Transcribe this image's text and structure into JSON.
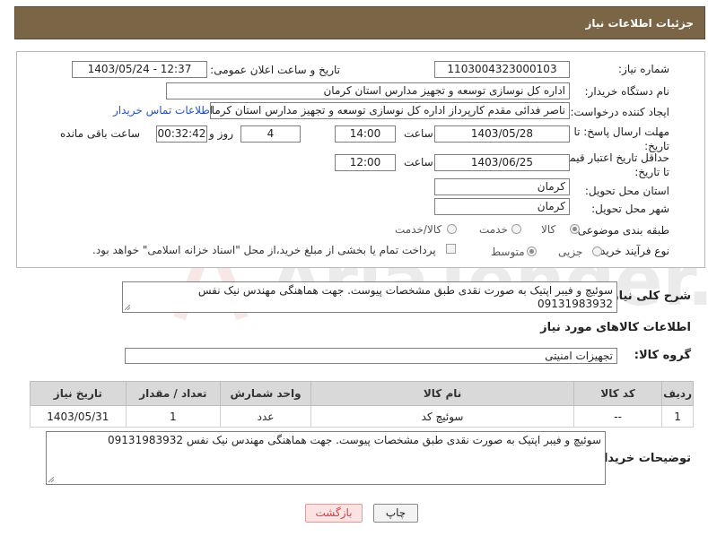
{
  "header": {
    "title": "جزئیات اطلاعات نیاز"
  },
  "form": {
    "need_number_label": "شماره نیاز:",
    "need_number": "1103004323000103",
    "announce_label": "تاریخ و ساعت اعلان عمومی:",
    "announce_value": "1403/05/24 - 12:37",
    "buyer_label": "نام دستگاه خریدار:",
    "buyer_value": "اداره کل نوسازی  توسعه و تجهیز مدارس استان کرمان",
    "creator_label": "ایجاد کننده درخواست:",
    "creator_value": "ناصر فدائی مقدم کارپرداز اداره کل نوسازی  توسعه و تجهیز مدارس استان کرمان",
    "contact_link": "اطلاعات تماس خریدار",
    "deadline_label": "مهلت ارسال پاسخ: تا تاریخ:",
    "deadline_date": "1403/05/28",
    "time_label": "ساعت",
    "deadline_time": "14:00",
    "days_value": "4",
    "days_label": "روز و",
    "remaining_time": "00:32:42",
    "remaining_label": "ساعت باقی مانده",
    "validity_label": "حداقل تاریخ اعتبار قیمت: تا تاریخ:",
    "validity_date": "1403/06/25",
    "validity_time": "12:00",
    "province_label": "استان محل تحویل:",
    "province_value": "کرمان",
    "city_label": "شهر محل تحویل:",
    "city_value": "کرمان",
    "category_label": "طبقه بندی موضوعی:",
    "category_options": [
      "کالا",
      "خدمت",
      "کالا/خدمت"
    ],
    "category_selected": "کالا",
    "process_label": "نوع فرآیند خرید :",
    "process_options": [
      "جزیی",
      "متوسط"
    ],
    "process_selected": "متوسط",
    "payment_note": "پرداخت تمام یا بخشی از مبلغ خرید،از محل \"اسناد خزانه اسلامی\" خواهد بود."
  },
  "summary": {
    "label": "شرح کلی نیاز:",
    "text_line1": "سوئیچ و فیبر اپتیک به صورت نقدی طبق مشخصات پیوست. جهت هماهنگی مهندس نیک نفس",
    "text_line2": "09131983932"
  },
  "goods": {
    "section_title": "اطلاعات کالاهای مورد نیاز",
    "group_label": "گروه کالا:",
    "group_value": "تجهیزات امنیتی",
    "columns": [
      "ردیف",
      "کد کالا",
      "نام کالا",
      "واحد شمارش",
      "تعداد / مقدار",
      "تاریخ نیاز"
    ],
    "rows": [
      [
        "1",
        "--",
        "سوئیچ کد",
        "عدد",
        "1",
        "1403/05/31"
      ]
    ]
  },
  "buyer_notes": {
    "label": "توضیحات خریدار:",
    "text": "سوئیچ و فیبر اپتیک به صورت نقدی طبق مشخصات پیوست. جهت هماهنگی مهندس نیک نفس 09131983932"
  },
  "buttons": {
    "print": "چاپ",
    "back": "بازگشت"
  },
  "watermark": {
    "text": "AriaTender.neT"
  }
}
